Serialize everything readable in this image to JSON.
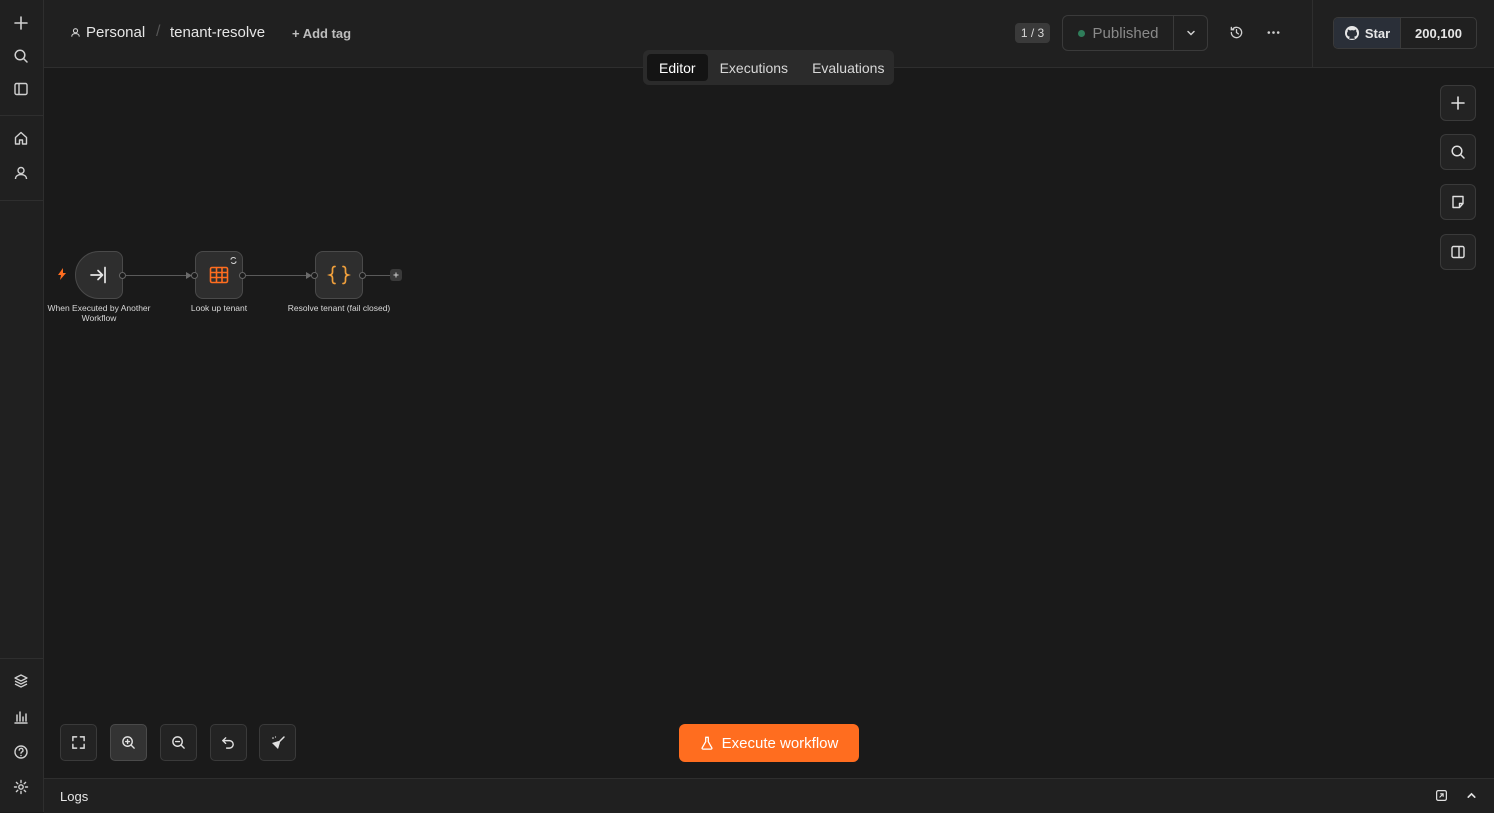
{
  "header": {
    "project": "Personal",
    "workflow_name": "tenant-resolve",
    "add_tag": "+ Add tag",
    "version_counter": "1 / 3",
    "publish_status": "Published",
    "github_star": "Star",
    "github_count": "200,100"
  },
  "tabs": [
    {
      "label": "Editor",
      "active": true
    },
    {
      "label": "Executions",
      "active": false
    },
    {
      "label": "Evaluations",
      "active": false
    }
  ],
  "nodes": [
    {
      "label": "When Executed by Another Workflow",
      "icon": "sign-in-arrow-icon"
    },
    {
      "label": "Look up tenant",
      "icon": "table-icon"
    },
    {
      "label": "Resolve tenant (fail closed)",
      "icon": "curly-braces-icon"
    }
  ],
  "execute_button": "Execute workflow",
  "logs_label": "Logs",
  "colors": {
    "accent": "#ff6d1f",
    "background": "#1a1a1a",
    "published_dot": "#2f7d5a",
    "code_icon": "#f0a03c"
  }
}
